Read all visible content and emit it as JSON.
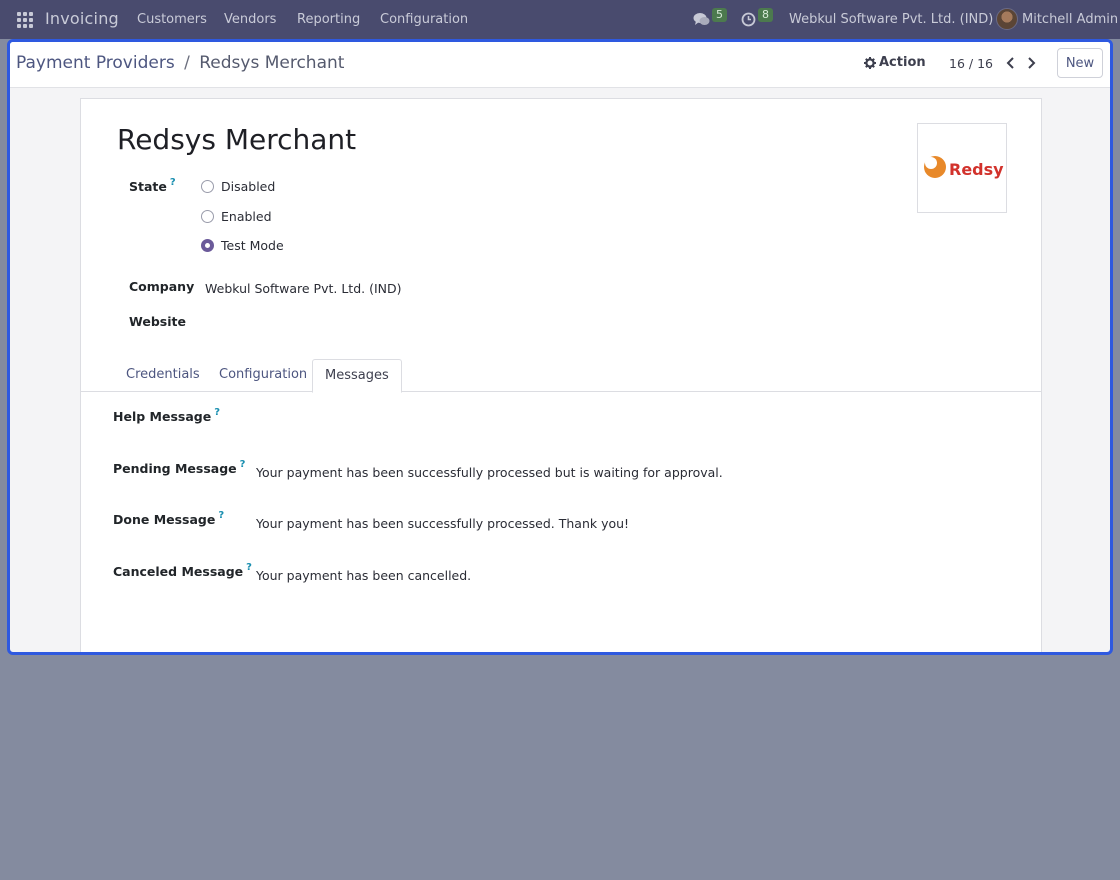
{
  "navbar": {
    "brand": "Invoicing",
    "menu": [
      "Customers",
      "Vendors",
      "Reporting",
      "Configuration"
    ],
    "messages_count": "5",
    "activities_count": "8",
    "company": "Webkul Software Pvt. Ltd. (IND)",
    "user_name": "Mitchell Admin"
  },
  "control_panel": {
    "breadcrumb_parent": "Payment Providers",
    "breadcrumb_separator": "/",
    "breadcrumb_current": "Redsys Merchant",
    "action_label": "Action",
    "pager": "16 / 16",
    "new_label": "New"
  },
  "form": {
    "title": "Redsys Merchant",
    "logo_text": "Redsys",
    "state_label": "State",
    "help_mark": "?",
    "state_options": [
      "Disabled",
      "Enabled",
      "Test Mode"
    ],
    "state_selected": "Test Mode",
    "company_label": "Company",
    "company_value": "Webkul Software Pvt. Ltd. (IND)",
    "website_label": "Website",
    "website_value": ""
  },
  "tabs": [
    "Credentials",
    "Configuration",
    "Messages"
  ],
  "active_tab": "Messages",
  "messages": {
    "help_label": "Help Message",
    "help_value": "",
    "pending_label": "Pending Message",
    "pending_value": "Your payment has been successfully processed but is waiting for approval.",
    "done_label": "Done Message",
    "done_value": "Your payment has been successfully processed. Thank you!",
    "canceled_label": "Canceled Message",
    "canceled_value": "Your payment has been cancelled."
  },
  "colors": {
    "navbar_bg": "#494b6e",
    "frame_highlight": "#2e59e0",
    "radio_checked": "#6b5a9a",
    "backdrop": "#848b9f",
    "logo_orange": "#e8892a",
    "logo_red": "#d2322c"
  }
}
